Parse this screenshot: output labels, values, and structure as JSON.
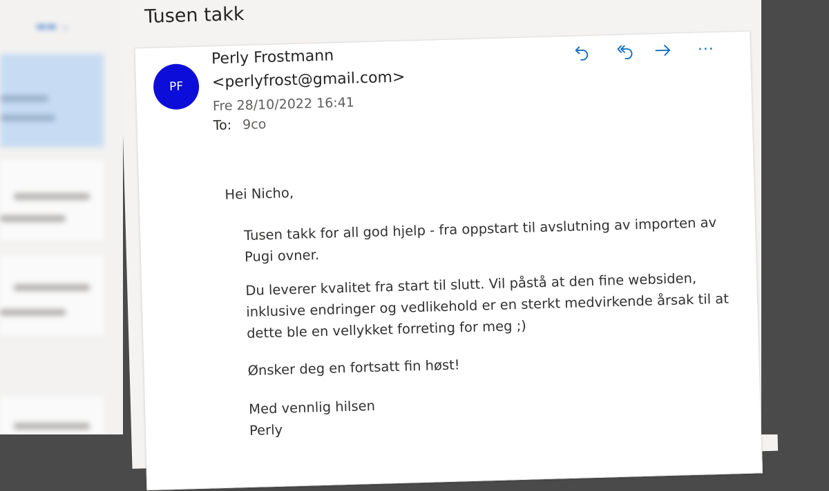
{
  "subject": "Tusen takk",
  "sender": {
    "initials": "PF",
    "name": "Perly Frostmann",
    "email": "<perlyfrost@gmail.com>",
    "date": "Fre 28/10/2022 16:41",
    "to_label": "To:",
    "to_value": "9co"
  },
  "actions": [
    {
      "icon": "reply-icon"
    },
    {
      "icon": "reply-all-icon"
    },
    {
      "icon": "forward-icon"
    },
    {
      "icon": "more-icon",
      "label": "···"
    }
  ],
  "body": {
    "greeting": "Hei Nicho,",
    "p1_line1": "Tusen takk for all god hjelp - fra oppstart til avslutning av importen av",
    "p1_line2": "Pugi  ovner.",
    "p2_line1": "Du leverer kvalitet fra start til slutt. Vil påstå at den fine websiden,",
    "p2_line2": "inklusive endringer og vedlikehold er en sterkt medvirkende årsak til at",
    "p2_line3": "dette ble en vellykket forreting for meg ;)",
    "p3": "Ønsker deg en fortsatt fin høst!",
    "closing": "Med vennlig hilsen",
    "signature": "Perly"
  },
  "colors": {
    "accent": "#0f6cbd",
    "avatar_bg": "#0d0dda",
    "selected_row": "#c7dcf3"
  }
}
